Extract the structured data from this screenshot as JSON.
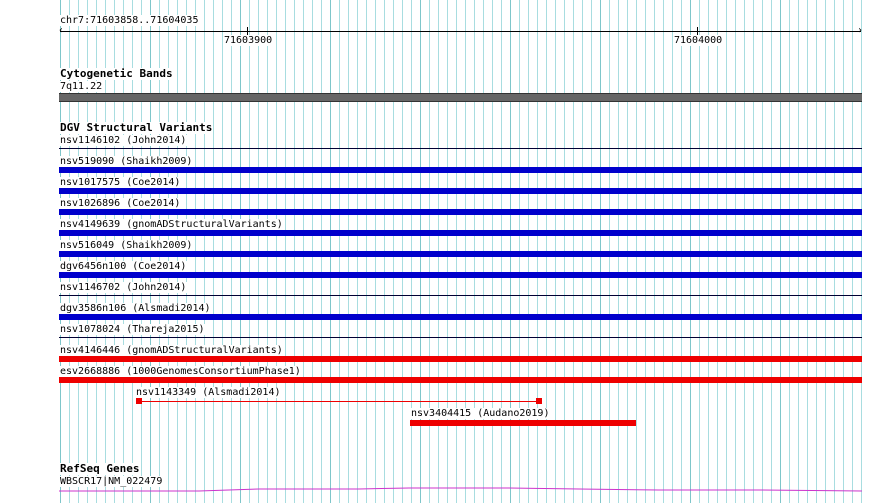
{
  "ruler": {
    "position_label": "chr7:71603858..71604035",
    "tick_labels": [
      "71603900",
      "71604000"
    ]
  },
  "cytobands": {
    "title": "Cytogenetic Bands",
    "band_label": "7q11.22",
    "band_color": "#666666"
  },
  "dgv": {
    "title": "DGV Structural Variants",
    "colors": {
      "loss": "#0000cc",
      "gain": "#ee0000",
      "separator": "#000033"
    },
    "features": [
      {
        "label": "nsv1146102 (John2014)",
        "type": "none"
      },
      {
        "label": "nsv519090 (Shaikh2009)",
        "type": "loss"
      },
      {
        "label": "nsv1017575 (Coe2014)",
        "type": "loss"
      },
      {
        "label": "nsv1026896 (Coe2014)",
        "type": "loss"
      },
      {
        "label": "nsv4149639 (gnomADStructuralVariants)",
        "type": "loss"
      },
      {
        "label": "nsv516049 (Shaikh2009)",
        "type": "loss"
      },
      {
        "label": "dgv6456n100 (Coe2014)",
        "type": "loss"
      },
      {
        "label": "nsv1146702 (John2014)",
        "type": "none"
      },
      {
        "label": "dgv3586n106 (Alsmadi2014)",
        "type": "loss"
      },
      {
        "label": "nsv1078024 (Thareja2015)",
        "type": "none"
      },
      {
        "label": "nsv4146446 (gnomADStructuralVariants)",
        "type": "gain"
      },
      {
        "label": "esv2668886 (1000GenomesConsortiumPhase1)",
        "type": "gain"
      }
    ],
    "partial_features": [
      {
        "label": "nsv1143349 (Alsmadi2014)",
        "type": "gain"
      },
      {
        "label": "nsv3404415 (Audano2019)",
        "type": "gain"
      }
    ]
  },
  "refseq": {
    "title": "RefSeq Genes",
    "gene_label": "WBSCR17|NM_022479",
    "line_color": "#cc33cc"
  }
}
